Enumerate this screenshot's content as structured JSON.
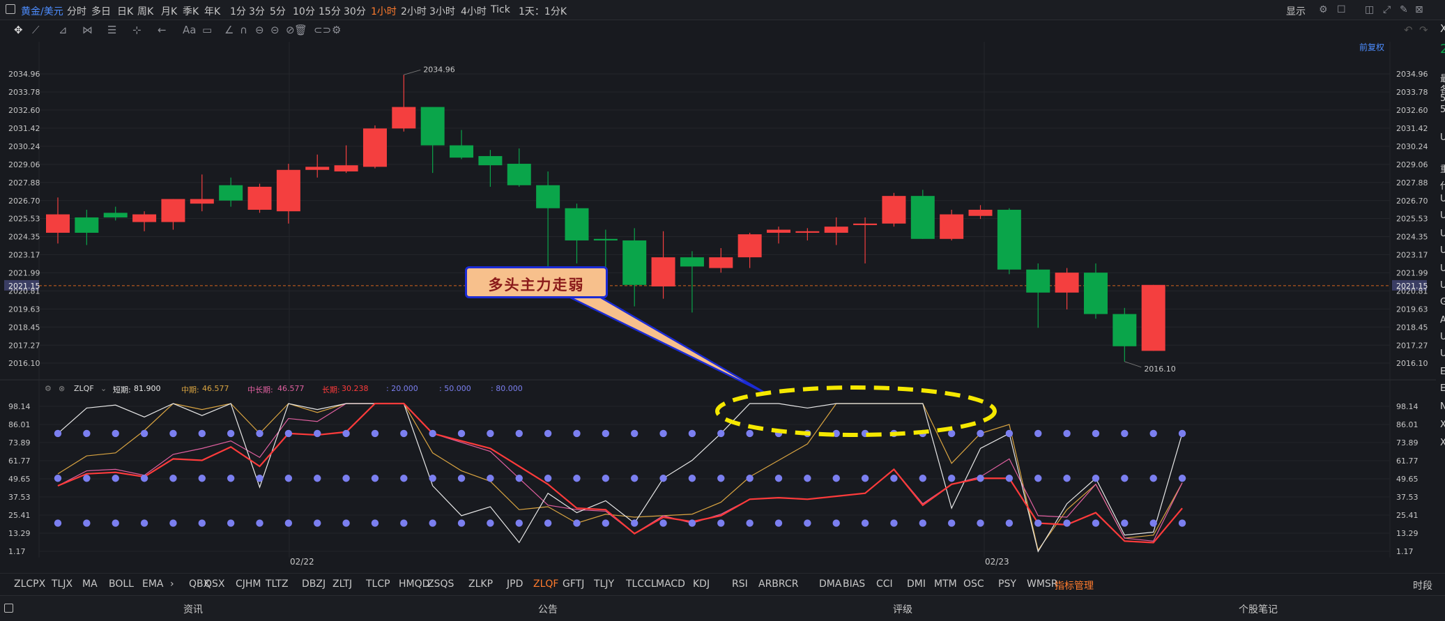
{
  "header": {
    "symbol": "黄金/美元",
    "timeframes": [
      "分时",
      "多日",
      "日K",
      "周K",
      "月K",
      "季K",
      "年K",
      "1分",
      "3分",
      "5分",
      "10分",
      "15分",
      "30分",
      "1小时",
      "2小时",
      "3小时",
      "4小时",
      "Tick",
      "1天：1分K"
    ],
    "active_timeframe": "1小时",
    "display_label": "显示"
  },
  "price_axis": {
    "labels": [
      "2034.96",
      "2033.78",
      "2032.60",
      "2031.42",
      "2030.24",
      "2029.06",
      "2027.88",
      "2026.70",
      "2025.53",
      "2024.35",
      "2023.17",
      "2021.99",
      "2020.81",
      "2019.63",
      "2018.45",
      "2017.27",
      "2016.10"
    ],
    "right_labels": [
      "2034.96",
      "2033.78",
      "2032.60",
      "2031.42",
      "2030.24",
      "2029.06",
      "2027.88",
      "2026.70",
      "2025.53",
      "2024.35",
      "2023.17",
      "2021.99",
      "2020.81",
      "2019.63",
      "2018.45",
      "2017.27",
      "2016.10"
    ],
    "current_price": "2021.15",
    "max_label": "2034.96",
    "min_label": "2016.10",
    "fuquan_label": "前复权"
  },
  "candles": [
    {
      "o": 2024.6,
      "h": 2026.9,
      "l": 2023.9,
      "c": 2025.8
    },
    {
      "o": 2025.6,
      "h": 2026.1,
      "l": 2023.8,
      "c": 2024.6
    },
    {
      "o": 2025.9,
      "h": 2026.3,
      "l": 2025.4,
      "c": 2025.6
    },
    {
      "o": 2025.3,
      "h": 2026.0,
      "l": 2024.7,
      "c": 2025.8
    },
    {
      "o": 2025.3,
      "h": 2026.8,
      "l": 2024.8,
      "c": 2026.8
    },
    {
      "o": 2026.5,
      "h": 2028.4,
      "l": 2026.0,
      "c": 2026.8
    },
    {
      "o": 2027.7,
      "h": 2028.2,
      "l": 2026.3,
      "c": 2026.7
    },
    {
      "o": 2026.1,
      "h": 2027.8,
      "l": 2025.9,
      "c": 2027.6
    },
    {
      "o": 2026.0,
      "h": 2029.1,
      "l": 2025.2,
      "c": 2028.7
    },
    {
      "o": 2028.7,
      "h": 2029.7,
      "l": 2028.2,
      "c": 2028.9
    },
    {
      "o": 2028.6,
      "h": 2030.3,
      "l": 2028.5,
      "c": 2029.0
    },
    {
      "o": 2028.9,
      "h": 2031.6,
      "l": 2028.8,
      "c": 2031.4
    },
    {
      "o": 2031.4,
      "h": 2034.9,
      "l": 2031.2,
      "c": 2032.8
    },
    {
      "o": 2032.8,
      "h": 2032.8,
      "l": 2028.5,
      "c": 2030.3
    },
    {
      "o": 2030.3,
      "h": 2031.3,
      "l": 2029.4,
      "c": 2029.5
    },
    {
      "o": 2029.6,
      "h": 2030.0,
      "l": 2027.6,
      "c": 2029.0
    },
    {
      "o": 2029.1,
      "h": 2030.1,
      "l": 2027.6,
      "c": 2027.7
    },
    {
      "o": 2027.7,
      "h": 2028.6,
      "l": 2022.4,
      "c": 2026.2
    },
    {
      "o": 2026.2,
      "h": 2026.5,
      "l": 2022.6,
      "c": 2024.1
    },
    {
      "o": 2024.2,
      "h": 2024.8,
      "l": 2021.6,
      "c": 2024.1
    },
    {
      "o": 2024.1,
      "h": 2024.9,
      "l": 2019.8,
      "c": 2021.2
    },
    {
      "o": 2021.1,
      "h": 2024.7,
      "l": 2020.3,
      "c": 2023.0
    },
    {
      "o": 2023.0,
      "h": 2023.4,
      "l": 2019.4,
      "c": 2022.4
    },
    {
      "o": 2022.3,
      "h": 2023.6,
      "l": 2022.0,
      "c": 2023.0
    },
    {
      "o": 2023.0,
      "h": 2024.6,
      "l": 2022.3,
      "c": 2024.5
    },
    {
      "o": 2024.6,
      "h": 2025.0,
      "l": 2023.9,
      "c": 2024.8
    },
    {
      "o": 2024.6,
      "h": 2024.9,
      "l": 2024.1,
      "c": 2024.7
    },
    {
      "o": 2024.6,
      "h": 2025.6,
      "l": 2023.8,
      "c": 2025.0
    },
    {
      "o": 2025.1,
      "h": 2025.6,
      "l": 2022.6,
      "c": 2025.2
    },
    {
      "o": 2025.2,
      "h": 2027.2,
      "l": 2025.0,
      "c": 2027.0
    },
    {
      "o": 2027.0,
      "h": 2027.4,
      "l": 2024.2,
      "c": 2024.2
    },
    {
      "o": 2024.2,
      "h": 2026.1,
      "l": 2024.1,
      "c": 2025.8
    },
    {
      "o": 2025.7,
      "h": 2026.4,
      "l": 2025.5,
      "c": 2026.1
    },
    {
      "o": 2026.1,
      "h": 2026.2,
      "l": 2021.9,
      "c": 2022.2
    },
    {
      "o": 2022.2,
      "h": 2022.6,
      "l": 2018.4,
      "c": 2020.7
    },
    {
      "o": 2020.7,
      "h": 2022.3,
      "l": 2019.6,
      "c": 2022.0
    },
    {
      "o": 2022.0,
      "h": 2022.6,
      "l": 2019.0,
      "c": 2019.3
    },
    {
      "o": 2019.3,
      "h": 2019.7,
      "l": 2016.2,
      "c": 2017.2
    },
    {
      "o": 2016.9,
      "h": 2021.2,
      "l": 2016.9,
      "c": 2021.2
    }
  ],
  "indicator": {
    "name": "ZLQF",
    "short_label": "短期:",
    "short_value": "81.900",
    "mid_label": "中期:",
    "mid_value": "46.577",
    "midlong_label": "中长期:",
    "midlong_value": "46.577",
    "long_label": "长期:",
    "long_value": "30.238",
    "ref1": ": 20.000",
    "ref2": ": 50.000",
    "ref3": ": 80.000",
    "axis_labels": [
      "98.14",
      "86.01",
      "73.89",
      "61.77",
      "49.65",
      "37.53",
      "25.41",
      "13.29",
      "1.17"
    ],
    "ref_levels": [
      20,
      50,
      80
    ],
    "colors": {
      "short": "#e8e8e8",
      "mid": "#d9a441",
      "midlong": "#e060a0",
      "long": "#ff3b3b",
      "dots": "#7b7ff0"
    },
    "short": [
      80,
      97,
      99,
      91,
      100,
      92,
      100,
      44,
      100,
      96,
      100,
      100,
      100,
      45,
      25,
      31,
      7,
      40,
      27,
      35,
      20,
      50,
      62,
      80,
      100,
      100,
      97,
      100,
      100,
      100,
      100,
      30,
      70,
      80,
      1,
      33,
      50,
      12,
      14,
      80
    ],
    "mid": [
      53,
      65,
      67,
      82,
      100,
      96,
      100,
      80,
      100,
      94,
      100,
      100,
      100,
      67,
      55,
      48,
      29,
      31,
      20,
      26,
      24,
      25,
      26,
      34,
      51,
      62,
      73,
      100,
      100,
      100,
      100,
      60,
      80,
      86,
      2,
      29,
      46,
      10,
      12,
      47
    ],
    "midlong": [
      45,
      55,
      56,
      52,
      66,
      70,
      75,
      64,
      90,
      88,
      100,
      100,
      100,
      80,
      74,
      68,
      50,
      32,
      29,
      28,
      13,
      25,
      20,
      26,
      36,
      37,
      36,
      38,
      40,
      56,
      33,
      46,
      51,
      63,
      25,
      24,
      46,
      10,
      8,
      47
    ],
    "long": [
      45,
      53,
      54,
      51,
      63,
      62,
      71,
      58,
      80,
      79,
      81,
      100,
      100,
      80,
      75,
      70,
      58,
      46,
      30,
      29,
      13,
      24,
      21,
      25,
      36,
      37,
      36,
      38,
      40,
      56,
      32,
      46,
      50,
      50,
      20,
      19,
      27,
      8,
      7,
      30
    ]
  },
  "x_axis": {
    "label_1": "02/22",
    "label_2": "02/23"
  },
  "annotation": {
    "callout_text": "多头主力走弱"
  },
  "tabs": [
    "ZLCPX",
    "TLJX",
    "MA",
    "BOLL",
    "EMA",
    "QBX",
    "QSX",
    "CJHM",
    "TLTZ",
    "DBZJ",
    "ZLTJ",
    "TLCP",
    "HMQD",
    "ZSQS",
    "ZLKP",
    "JPD",
    "ZLQF",
    "GFTJ",
    "TLJY",
    "TLCCL",
    "MACD",
    "KDJ",
    "RSI",
    "ARBR",
    "CR",
    "DMA",
    "BIAS",
    "CCI",
    "DMI",
    "MTM",
    "OSC",
    "PSY",
    "WMSR",
    "指标管理"
  ],
  "active_tab": "ZLQF",
  "time_label": "时段",
  "footer": {
    "news": "资讯",
    "announcement": "公告",
    "rating": "评级",
    "notes": "个股笔记"
  },
  "side_letters": [
    "X",
    "2",
    "",
    "最",
    "各",
    "5",
    "5",
    "",
    "U",
    "",
    "重",
    "代",
    "U",
    "U",
    "U",
    "U",
    "U",
    "U",
    "G",
    "A",
    "U",
    "U",
    "E",
    "E",
    "N",
    "X",
    "X"
  ]
}
